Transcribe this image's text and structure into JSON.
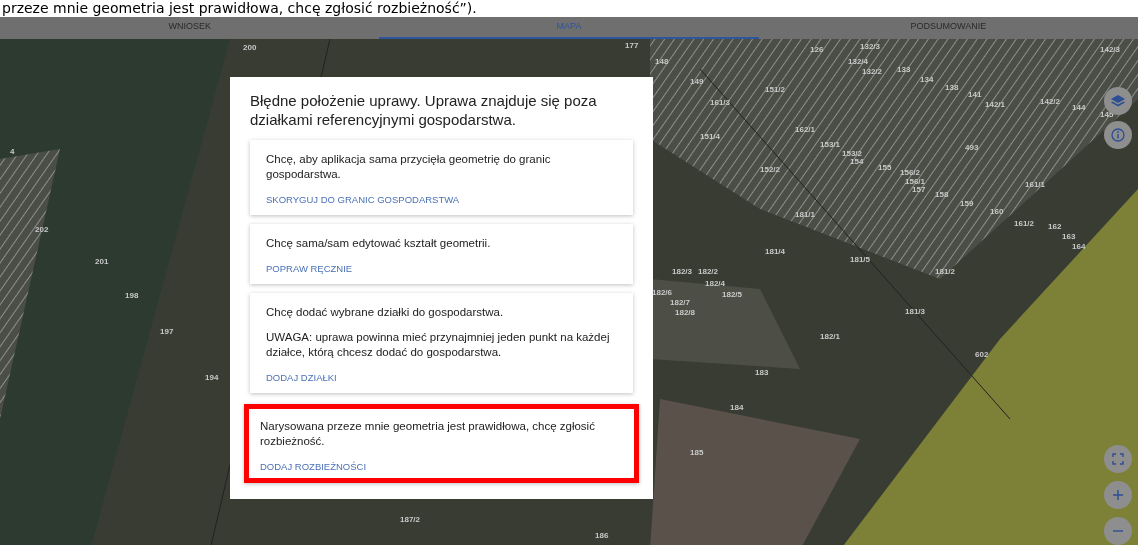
{
  "caption": "przeze mnie geometria jest prawidłowa, chcę zgłosić rozbieżność”).",
  "tabs": [
    {
      "label": "WNIOSEK",
      "selected": false
    },
    {
      "label": "MAPA",
      "selected": true
    },
    {
      "label": "PODSUMOWANIE",
      "selected": false
    }
  ],
  "map_labels": [
    "200",
    "177",
    "148",
    "149",
    "126",
    "132/3",
    "132/4",
    "132/2",
    "133",
    "134",
    "138",
    "141",
    "142/1",
    "142/2",
    "144",
    "145",
    "142/3",
    "151/2",
    "161/3",
    "151/4",
    "162/1",
    "153/1",
    "153/2",
    "154",
    "155",
    "156/2",
    "156/1",
    "157",
    "158",
    "159",
    "160",
    "161/1",
    "493",
    "152/2",
    "181/1",
    "181/4",
    "181/5",
    "181/2",
    "161/2",
    "162",
    "163",
    "164",
    "182/3",
    "182/2",
    "182/4",
    "182/5",
    "182/6",
    "182/7",
    "182/8",
    "181/3",
    "182/1",
    "602",
    "183",
    "184",
    "185",
    "186",
    "187/2",
    "202",
    "201",
    "198",
    "197",
    "194",
    "4"
  ],
  "dialog": {
    "title": "Błędne położenie uprawy. Uprawa znajduje się poza działkami referencyjnymi gospodarstwa.",
    "options": [
      {
        "texts": [
          "Chcę, aby aplikacja sama przycięła geometrię do granic gospodarstwa."
        ],
        "action": "SKORYGUJ DO GRANIC GOSPODARSTWA",
        "highlighted": false
      },
      {
        "texts": [
          "Chcę sama/sam edytować kształt geometrii."
        ],
        "action": "POPRAW RĘCZNIE",
        "highlighted": false
      },
      {
        "texts": [
          "Chcę dodać wybrane działki do gospodarstwa.",
          "UWAGA: uprawa powinna mieć przynajmniej jeden punkt na każdej działce, którą chcesz dodać do gospodarstwa."
        ],
        "action": "DODAJ DZIAŁKI",
        "highlighted": false
      },
      {
        "texts": [
          "Narysowana przeze mnie geometria jest prawidłowa, chcę zgłosić rozbieżność."
        ],
        "action": "DODAJ ROZBIEŻNOŚCI",
        "highlighted": true
      }
    ]
  }
}
